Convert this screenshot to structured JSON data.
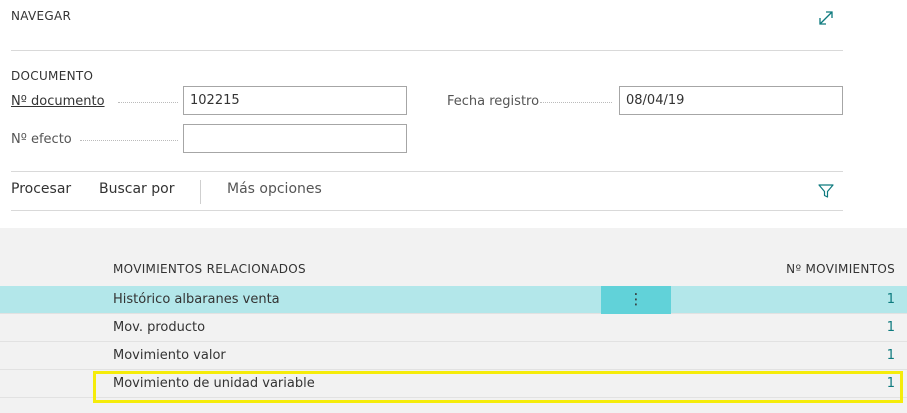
{
  "navigate": {
    "title": "NAVEGAR"
  },
  "document": {
    "title": "DOCUMENTO",
    "fields": {
      "doc_number": {
        "label": "Nº documento",
        "value": "102215"
      },
      "effect_number": {
        "label": "Nº efecto",
        "value": ""
      },
      "posting_date": {
        "label": "Fecha registro",
        "value": "08/04/19"
      }
    }
  },
  "actions": {
    "process": "Procesar",
    "find_by": "Buscar por",
    "more": "Más opciones"
  },
  "entries": {
    "header_name": "MOVIMIENTOS RELACIONADOS",
    "header_count": "Nº MOVIMIENTOS",
    "rows": [
      {
        "name": "Histórico albaranes venta",
        "count": "1"
      },
      {
        "name": "Mov. producto",
        "count": "1"
      },
      {
        "name": "Movimiento valor",
        "count": "1"
      },
      {
        "name": "Movimiento de unidad variable",
        "count": "1"
      }
    ],
    "row_menu_glyph": "⋮"
  },
  "colors": {
    "accent": "#0d7a7e",
    "selected_row": "#b3e7ea",
    "row_menu": "#61d2d9",
    "highlight": "#f5ec0a"
  }
}
